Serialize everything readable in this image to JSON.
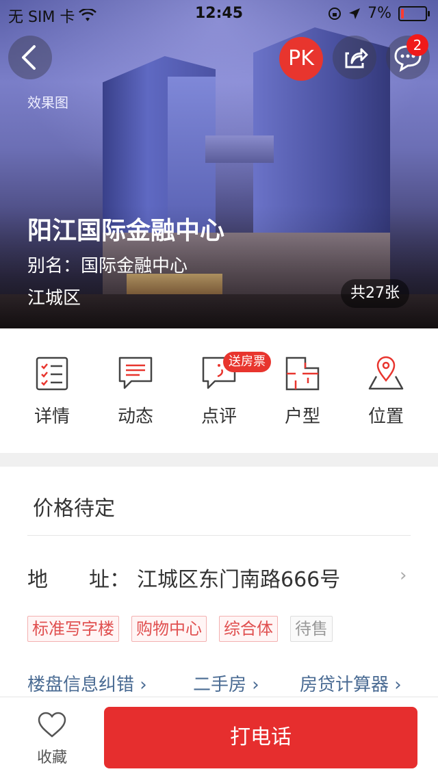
{
  "status_bar": {
    "carrier": "无 SIM 卡",
    "time": "12:45",
    "battery": "7%"
  },
  "header": {
    "pk_label": "PK",
    "message_badge": "2",
    "render_label": "效果图"
  },
  "hero": {
    "title": "阳江国际金融中心",
    "alias": "别名：国际金融中心",
    "district": "江城区",
    "photo_count": "共27张"
  },
  "nav": {
    "items": [
      {
        "label": "详情",
        "icon": "checklist-icon"
      },
      {
        "label": "动态",
        "icon": "message-lines-icon"
      },
      {
        "label": "点评",
        "icon": "comment-smile-icon"
      },
      {
        "label": "户型",
        "icon": "floorplan-icon"
      },
      {
        "label": "位置",
        "icon": "location-pin-icon"
      }
    ],
    "review_badge": "送房票"
  },
  "info": {
    "price": "价格待定",
    "address_label_1": "地",
    "address_label_2": "址：",
    "address_value": "江城区东门南路666号",
    "address_arrow": "›",
    "tags": [
      "标准写字楼",
      "购物中心",
      "综合体",
      "待售"
    ],
    "links": [
      "楼盘信息纠错 ›",
      "二手房 ›",
      "房贷计算器 ›"
    ]
  },
  "bottom": {
    "favorite_label": "收藏",
    "call_label": "打电话"
  },
  "colors": {
    "accent": "#e62e2e",
    "link": "#4a6b93",
    "tag_text": "#e05050"
  }
}
